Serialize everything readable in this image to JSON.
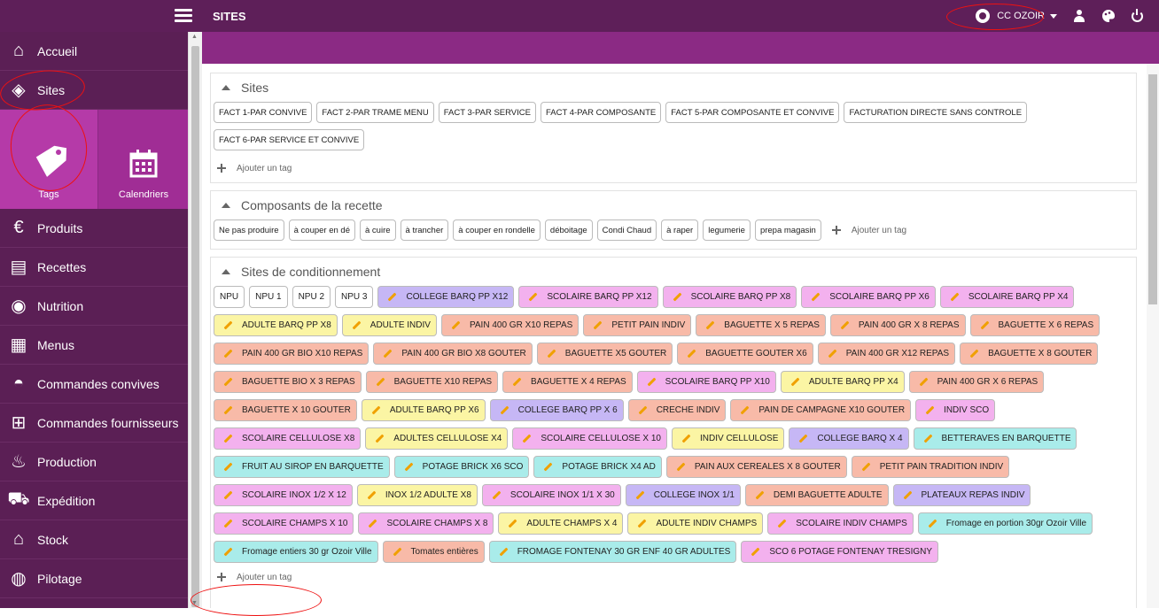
{
  "topbar": {
    "title": "SITES",
    "site_selector": "CC OZOIR"
  },
  "sidebar": {
    "items": [
      {
        "label": "Accueil",
        "icon": "home-icon"
      },
      {
        "label": "Sites",
        "icon": "tag-icon"
      },
      {
        "label": "Produits",
        "icon": "products-icon"
      },
      {
        "label": "Recettes",
        "icon": "recipes-icon"
      },
      {
        "label": "Nutrition",
        "icon": "nutrition-icon"
      },
      {
        "label": "Menus",
        "icon": "calendar-icon"
      },
      {
        "label": "Commandes convives",
        "icon": "cloche-icon"
      },
      {
        "label": "Commandes fournisseurs",
        "icon": "cart-icon"
      },
      {
        "label": "Production",
        "icon": "chef-icon"
      },
      {
        "label": "Expédition",
        "icon": "truck-icon"
      },
      {
        "label": "Stock",
        "icon": "warehouse-icon"
      },
      {
        "label": "Pilotage",
        "icon": "dashboard-icon"
      }
    ],
    "sub_items": [
      {
        "label": "Tags",
        "icon": "tag-icon"
      },
      {
        "label": "Calendriers",
        "icon": "calendar-icon"
      }
    ]
  },
  "panels": {
    "sites": {
      "title": "Sites",
      "tags": [
        "FACT 1-PAR CONVIVE",
        "FACT 2-PAR TRAME MENU",
        "FACT 3-PAR SERVICE",
        "FACT 4-PAR COMPOSANTE",
        "FACT 5-PAR COMPOSANTE ET CONVIVE",
        "FACTURATION DIRECTE SANS CONTROLE",
        "FACT 6-PAR SERVICE ET CONVIVE"
      ],
      "add_label": "Ajouter un tag"
    },
    "composants": {
      "title": "Composants de la recette",
      "tags": [
        "Ne pas produire",
        "à couper en dé",
        "à cuire",
        "à trancher",
        "à couper en rondelle",
        "déboitage",
        "Condi Chaud",
        "à raper",
        "legumerie",
        "prepa magasin"
      ],
      "add_label": "Ajouter un tag"
    },
    "conditionnement": {
      "title": "Sites de conditionnement",
      "add_label": "Ajouter un tag",
      "tags": [
        {
          "label": "NPU",
          "color": "#ffffff"
        },
        {
          "label": "NPU 1",
          "color": "#ffffff"
        },
        {
          "label": "NPU 2",
          "color": "#ffffff"
        },
        {
          "label": "NPU 3",
          "color": "#ffffff"
        },
        {
          "label": "COLLEGE BARQ PP X12",
          "color": "#c6b7f5"
        },
        {
          "label": "SCOLAIRE BARQ PP X12",
          "color": "#f3b1ee"
        },
        {
          "label": "SCOLAIRE BARQ PP X8",
          "color": "#f3b1ee"
        },
        {
          "label": "SCOLAIRE BARQ PP X6",
          "color": "#f3b1ee"
        },
        {
          "label": "SCOLAIRE BARQ PP X4",
          "color": "#f3b1ee"
        },
        {
          "label": "ADULTE BARQ PP X8",
          "color": "#fbf5a4"
        },
        {
          "label": "ADULTE INDIV",
          "color": "#fbf5a4"
        },
        {
          "label": "PAIN 400 GR X10 REPAS",
          "color": "#f8baa8"
        },
        {
          "label": "PETIT PAIN INDIV",
          "color": "#f8baa8"
        },
        {
          "label": "BAGUETTE X 5 REPAS",
          "color": "#f8baa8"
        },
        {
          "label": "PAIN 400 GR X 8 REPAS",
          "color": "#f8baa8"
        },
        {
          "label": "BAGUETTE X 6 REPAS",
          "color": "#f8baa8"
        },
        {
          "label": "PAIN 400 GR BIO X10 REPAS",
          "color": "#f8baa8"
        },
        {
          "label": "PAIN 400 GR BIO X8 GOUTER",
          "color": "#f8baa8"
        },
        {
          "label": "BAGUETTE X5 GOUTER",
          "color": "#f8baa8"
        },
        {
          "label": "BAGUETTE GOUTER X6",
          "color": "#f8baa8"
        },
        {
          "label": "PAIN 400 GR X12 REPAS",
          "color": "#f8baa8"
        },
        {
          "label": "BAGUETTE X 8 GOUTER",
          "color": "#f8baa8"
        },
        {
          "label": "BAGUETTE BIO X 3 REPAS",
          "color": "#f8baa8"
        },
        {
          "label": "BAGUETTE X10 REPAS",
          "color": "#f8baa8"
        },
        {
          "label": "BAGUETTE X 4 REPAS",
          "color": "#f8baa8"
        },
        {
          "label": "SCOLAIRE BARQ PP X10",
          "color": "#f3b1ee"
        },
        {
          "label": "ADULTE BARQ PP X4",
          "color": "#fbf5a4"
        },
        {
          "label": "PAIN 400 GR X 6 REPAS",
          "color": "#f8baa8"
        },
        {
          "label": "BAGUETTE X 10 GOUTER",
          "color": "#f8baa8"
        },
        {
          "label": "ADULTE BARQ PP X6",
          "color": "#fbf5a4"
        },
        {
          "label": "COLLEGE BARQ PP X 6",
          "color": "#c6b7f5"
        },
        {
          "label": "CRECHE INDIV",
          "color": "#f8baa8"
        },
        {
          "label": "PAIN DE CAMPAGNE X10 GOUTER",
          "color": "#f8baa8"
        },
        {
          "label": "INDIV SCO",
          "color": "#f3b1ee"
        },
        {
          "label": "SCOLAIRE CELLULOSE X8",
          "color": "#f3b1ee"
        },
        {
          "label": "ADULTES CELLULOSE X4",
          "color": "#fbf5a4"
        },
        {
          "label": "SCOLAIRE CELLULOSE X 10",
          "color": "#f3b1ee"
        },
        {
          "label": "INDIV CELLULOSE",
          "color": "#fbf5a4"
        },
        {
          "label": "COLLEGE BARQ X 4",
          "color": "#c6b7f5"
        },
        {
          "label": "BETTERAVES EN BARQUETTE",
          "color": "#a9ecea"
        },
        {
          "label": "FRUIT AU SIROP EN BARQUETTE",
          "color": "#a9ecea"
        },
        {
          "label": "POTAGE BRICK X6 SCO",
          "color": "#a9ecea"
        },
        {
          "label": "POTAGE BRICK X4 AD",
          "color": "#a9ecea"
        },
        {
          "label": "PAIN AUX CEREALES X 8 GOUTER",
          "color": "#f8baa8"
        },
        {
          "label": "PETIT PAIN TRADITION INDIV",
          "color": "#f8baa8"
        },
        {
          "label": "SCOLAIRE INOX 1/2 X 12",
          "color": "#f3b1ee"
        },
        {
          "label": "INOX 1/2 ADULTE X8",
          "color": "#fbf5a4"
        },
        {
          "label": "SCOLAIRE INOX 1/1 X 30",
          "color": "#f3b1ee"
        },
        {
          "label": "COLLEGE INOX 1/1",
          "color": "#c6b7f5"
        },
        {
          "label": "DEMI BAGUETTE ADULTE",
          "color": "#f8baa8"
        },
        {
          "label": "PLATEAUX REPAS INDIV",
          "color": "#c6b7f5"
        },
        {
          "label": "SCOLAIRE CHAMPS X 10",
          "color": "#f3b1ee"
        },
        {
          "label": "SCOLAIRE CHAMPS X 8",
          "color": "#f3b1ee"
        },
        {
          "label": "ADULTE CHAMPS X 4",
          "color": "#fbf5a4"
        },
        {
          "label": "ADULTE INDIV CHAMPS",
          "color": "#fbf5a4"
        },
        {
          "label": "SCOLAIRE INDIV CHAMPS",
          "color": "#f3b1ee"
        },
        {
          "label": "Fromage en portion 30gr Ozoir Ville",
          "color": "#a9ecea"
        },
        {
          "label": "Fromage entiers 30 gr Ozoir Ville",
          "color": "#a9ecea"
        },
        {
          "label": "Tomates entières",
          "color": "#f8baa8"
        },
        {
          "label": "FROMAGE FONTENAY 30 GR ENF 40 GR ADULTES",
          "color": "#a9ecea"
        },
        {
          "label": "SCO 6 POTAGE FONTENAY TRESIGNY",
          "color": "#f3b1ee"
        }
      ]
    }
  }
}
